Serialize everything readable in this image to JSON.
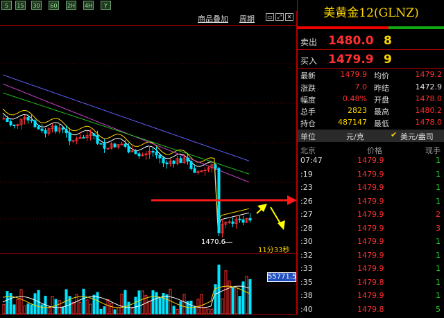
{
  "toolbar": {
    "buttons": [
      "5",
      "15",
      "30",
      "60",
      "2H",
      "4H",
      "Y"
    ]
  },
  "chart_header": {
    "overlay_label": "商品叠加",
    "period_label": "周期",
    "win_buttons": [
      "▭",
      "⤢",
      "✕"
    ]
  },
  "chart_annotations": {
    "low_label": "1470.6",
    "time_left": "11分33秒",
    "volume_value": "55771.5"
  },
  "colors": {
    "up": "#ff3030",
    "down": "#00e5ff",
    "ma_white": "#ffffff",
    "ma_yellow": "#ffd700",
    "ma_magenta": "#c040c0",
    "ma_green": "#20c020",
    "ma_blue": "#6060ff",
    "arrow_red": "#ff1a1a",
    "arrow_yellow": "#ffff00"
  },
  "quote": {
    "title": "美黄金12(GLNZ)",
    "sell_label": "卖出",
    "sell_price": "1480.0",
    "sell_vol": "8",
    "buy_label": "买入",
    "buy_price": "1479.9",
    "buy_vol": "9",
    "stats": [
      {
        "l1": "最新",
        "v1": "1479.9",
        "l2": "均价",
        "v2": "1479.2"
      },
      {
        "l1": "涨跌",
        "v1": "7.0",
        "l2": "昨结",
        "v2": "1472.9"
      },
      {
        "l1": "幅度",
        "v1": "0.48%",
        "l2": "开盘",
        "v2": "1478.0"
      },
      {
        "l1": "总手",
        "v1": "2823",
        "l2": "最高",
        "v2": "1480.2"
      },
      {
        "l1": "持仓",
        "v1": "487147",
        "l2": "最低",
        "v2": "1478.0"
      }
    ],
    "unit_label": "单位",
    "unit_value": "元/克",
    "unit_alt": "美元/盎司",
    "ticks_header": {
      "time": "北京",
      "price": "价格",
      "vol": "现手"
    },
    "ticks": [
      {
        "time": "07:47",
        "price": "1479.9",
        "vol": "1"
      },
      {
        "time": ":19",
        "price": "1479.9",
        "vol": "1"
      },
      {
        "time": ":23",
        "price": "1479.9",
        "vol": "1"
      },
      {
        "time": ":26",
        "price": "1479.9",
        "vol": "1"
      },
      {
        "time": ":27",
        "price": "1479.9",
        "vol": "2"
      },
      {
        "time": ":28",
        "price": "1479.9",
        "vol": "3"
      },
      {
        "time": ":30",
        "price": "1479.9",
        "vol": "1"
      },
      {
        "time": ":32",
        "price": "1479.9",
        "vol": "1"
      },
      {
        "time": ":33",
        "price": "1479.9",
        "vol": "1"
      },
      {
        "time": ":35",
        "price": "1479.8",
        "vol": "1"
      },
      {
        "time": ":38",
        "price": "1479.9",
        "vol": "1"
      },
      {
        "time": ":40",
        "price": "1479.8",
        "vol": "5"
      }
    ]
  }
}
